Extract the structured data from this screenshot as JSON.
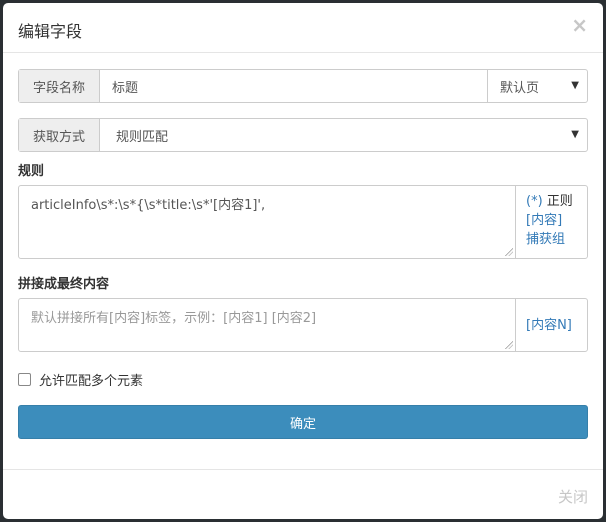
{
  "dialog": {
    "title": "编辑字段",
    "close_icon": "×",
    "close_label": "关闭"
  },
  "field_name": {
    "label": "字段名称",
    "value": "标题",
    "page_select": "默认页"
  },
  "method": {
    "label": "获取方式",
    "value": "规则匹配"
  },
  "rule": {
    "label": "规则",
    "value": "articleInfo\\s*:\\s*{\\s*title:\\s*'[内容1]',",
    "side_regex_link": "(*)",
    "side_regex_text": "正则",
    "side_content": "[内容]",
    "side_capture": "捕获组"
  },
  "concat": {
    "label": "拼接成最终内容",
    "placeholder": "默认拼接所有[内容]标签，示例：[内容1] [内容2]",
    "side_content_n": "[内容N]"
  },
  "multi_match": {
    "label": "允许匹配多个元素"
  },
  "confirm_label": "确定",
  "colors": {
    "primary": "#3c8dbc",
    "link": "#337ab7"
  }
}
